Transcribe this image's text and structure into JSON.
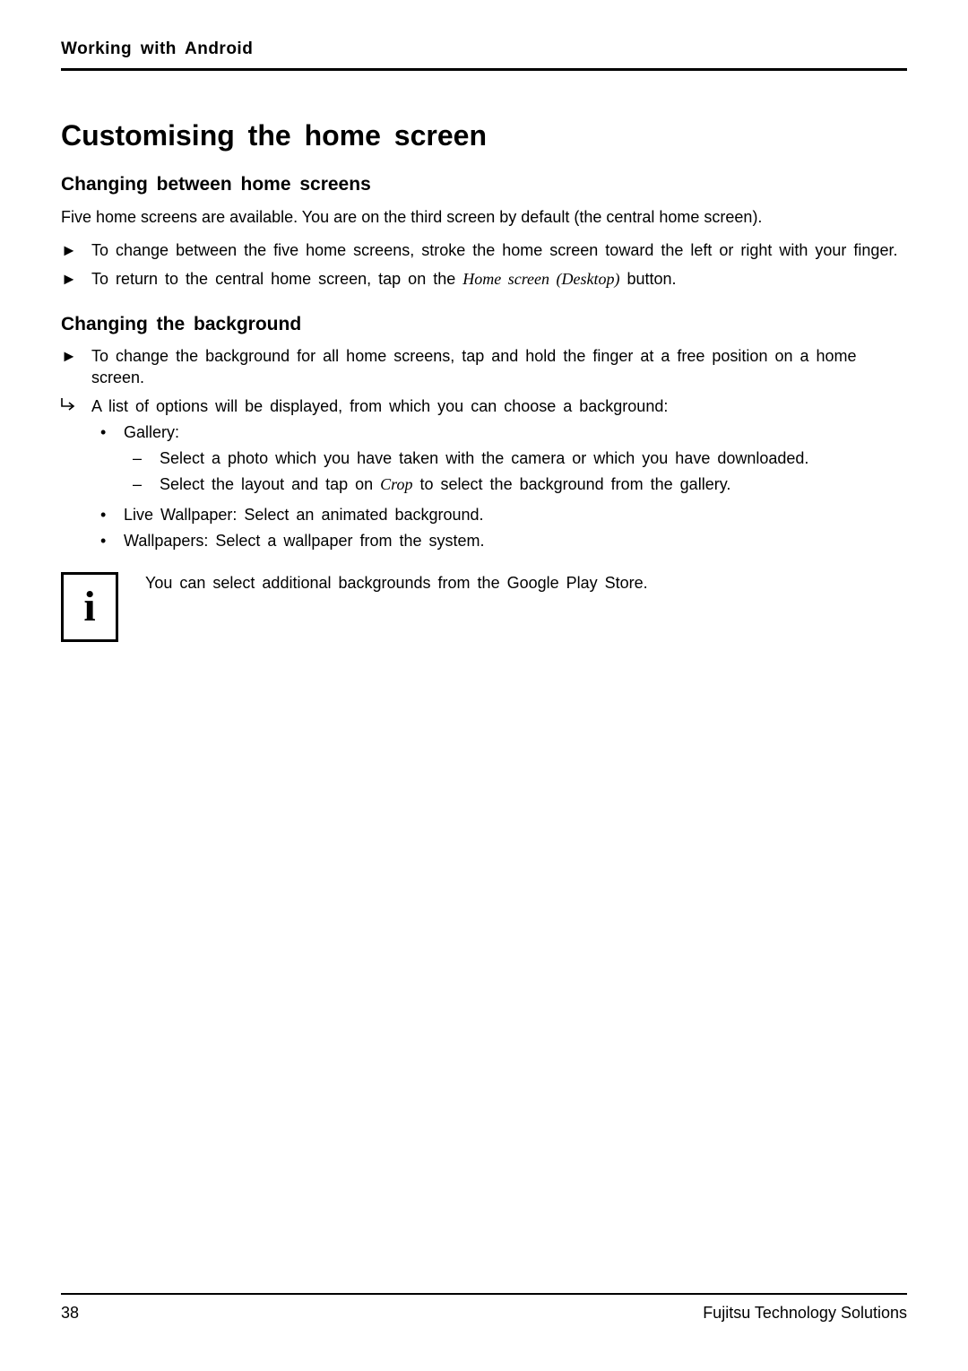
{
  "runningHead": "Working with Android",
  "h1": "Customising the home screen",
  "sectionA": {
    "title": "Changing between home screens",
    "intro": "Five home screens are available. You are on the third screen by default (the central home screen).",
    "steps": [
      "To change between the five home screens, stroke the home screen toward the left or right with your finger.",
      {
        "pre": "To return to the central home screen, tap on the ",
        "italic": "Home screen (Desktop)",
        "post": " button."
      }
    ]
  },
  "sectionB": {
    "title": "Changing the background",
    "step": "To change the background for all home screens, tap and hold the finger at a free position on a home screen.",
    "resultIntro": "A list of options will be displayed, from which you can choose a background:",
    "bullets": [
      {
        "label": "Gallery:",
        "dashes": [
          "Select a photo which you have taken with the camera or which you have downloaded.",
          {
            "pre": "Select the layout and tap on ",
            "italic": "Crop",
            "post": " to select the background from the gallery."
          }
        ]
      },
      {
        "label": "Live Wallpaper: Select an animated background."
      },
      {
        "label": "Wallpapers: Select a wallpaper from the system."
      }
    ],
    "infoNote": "You can select additional backgrounds from the Google Play Store."
  },
  "footer": {
    "pageNumber": "38",
    "company": "Fujitsu Technology Solutions"
  },
  "glyphs": {
    "infoI": "i"
  }
}
